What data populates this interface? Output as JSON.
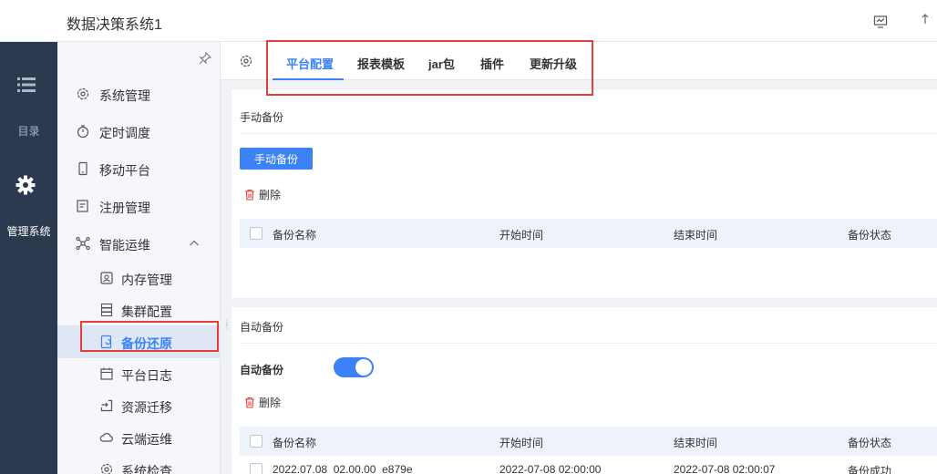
{
  "header": {
    "title": "数据决策系统1"
  },
  "rail": {
    "menu_label": "目录",
    "admin_label": "管理系统"
  },
  "sidebar": {
    "items": [
      {
        "label": "系统管理"
      },
      {
        "label": "定时调度"
      },
      {
        "label": "移动平台"
      },
      {
        "label": "注册管理"
      },
      {
        "label": "智能运维"
      }
    ],
    "subitems": [
      {
        "label": "内存管理"
      },
      {
        "label": "集群配置"
      },
      {
        "label": "备份还原"
      },
      {
        "label": "平台日志"
      },
      {
        "label": "资源迁移"
      },
      {
        "label": "云端运维"
      },
      {
        "label": "系统检查"
      }
    ]
  },
  "tabs": [
    {
      "label": "平台配置"
    },
    {
      "label": "报表模板"
    },
    {
      "label": "jar包"
    },
    {
      "label": "插件"
    },
    {
      "label": "更新升级"
    }
  ],
  "manual": {
    "title": "手动备份",
    "button": "手动备份",
    "delete": "删除",
    "columns": [
      "备份名称",
      "开始时间",
      "结束时间",
      "备份状态"
    ]
  },
  "auto": {
    "title": "自动备份",
    "toggle_label": "自动备份",
    "toggle_on": true,
    "delete": "删除",
    "columns": [
      "备份名称",
      "开始时间",
      "结束时间",
      "备份状态"
    ],
    "rows": [
      {
        "name": "2022.07.08_02.00.00_e879e",
        "start": "2022-07-08 02:00:00",
        "end": "2022-07-08 02:00:07",
        "status": "备份成功"
      }
    ]
  },
  "colors": {
    "accent": "#3b82f6",
    "rail": "#2c3a4f",
    "highlight_box": "#e53e3e"
  }
}
